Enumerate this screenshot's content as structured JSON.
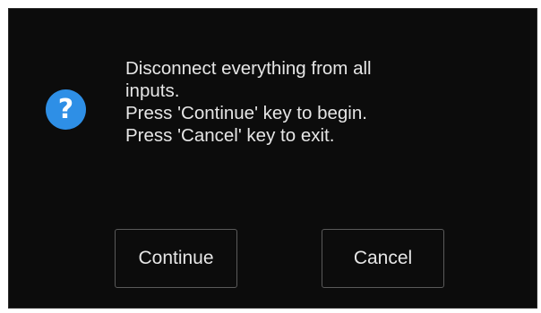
{
  "dialog": {
    "icon": "question-icon",
    "icon_glyph": "?",
    "icon_color": "#2e8fe6",
    "message_lines": [
      "Disconnect everything from all",
      "inputs.",
      "Press 'Continue' key to begin.",
      "Press 'Cancel' key to exit."
    ],
    "buttons": {
      "continue_label": "Continue",
      "cancel_label": "Cancel"
    }
  }
}
